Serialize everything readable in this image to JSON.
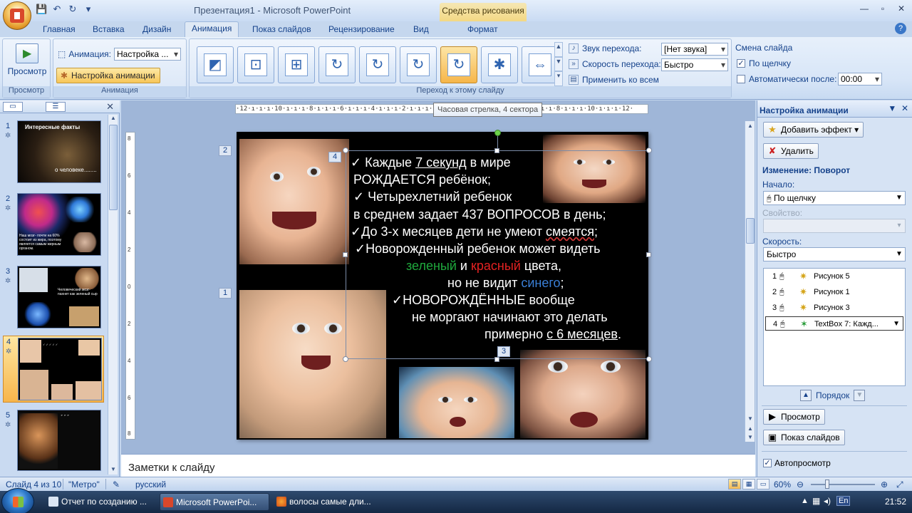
{
  "app": {
    "title": "Презентация1 - Microsoft PowerPoint",
    "contextual_tab": "Средства рисования"
  },
  "tabs": [
    "Главная",
    "Вставка",
    "Дизайн",
    "Анимация",
    "Показ слайдов",
    "Рецензирование",
    "Вид",
    "Формат"
  ],
  "active_tab": "Анимация",
  "ribbon": {
    "preview_group": {
      "button": "Просмотр",
      "label": "Просмотр"
    },
    "animations_group": {
      "animation_label": "Анимация:",
      "animation_value": "Настройка ...",
      "custom_button": "Настройка анимации",
      "label": "Анимация"
    },
    "transition_group": {
      "sound_label": "Звук перехода:",
      "sound_value": "[Нет звука]",
      "speed_label": "Скорость перехода:",
      "speed_value": "Быстро",
      "apply_all": "Применить ко всем",
      "label": "Переход к этому слайду"
    },
    "advance_group": {
      "title": "Смена слайда",
      "on_click": "По щелчку",
      "on_click_checked": true,
      "auto_after": "Автоматически после:",
      "auto_after_checked": false,
      "auto_time": "00:00"
    },
    "gallery_icons": [
      "wipe-icon",
      "box-in-icon",
      "box-out-icon",
      "wheel-1-icon",
      "wheel-2-icon",
      "wheel-3-icon",
      "wheel-4-icon",
      "wheel-8-icon",
      "split-icon"
    ]
  },
  "tooltip": "Часовая стрелка, 4 сектора",
  "ruler": "·12·ı·ı·ı·10·ı·ı·ı·8·ı·ı·ı·6·ı·ı·ı·4·ı·ı·ı·2·ı·ı·ı·0·ı·ı·ı·2·ı·ı·ı·4·ı·ı·ı·6·ı·ı·ı·8·ı·ı·ı·10·ı·ı·ı·12·",
  "ruler_v": [
    "8",
    "6",
    "4",
    "2",
    "0",
    "2",
    "4",
    "6",
    "8"
  ],
  "slides": [
    {
      "num": "1",
      "title": "Интересные факты",
      "sub": "о человеке........"
    },
    {
      "num": "2",
      "title": "",
      "sub": "Наш мозг- почти на 60% состоит из жира, поэтому является самым жирным органом."
    },
    {
      "num": "3",
      "title": "",
      "sub": "Человеческий мозг- пахнет как зеленый сыр"
    },
    {
      "num": "4",
      "title": "",
      "sub": ""
    },
    {
      "num": "5",
      "title": "",
      "sub": ""
    }
  ],
  "slide_content": {
    "l1a": "✓ Каждые ",
    "l1u": "7 секунд",
    "l1b": " в мире",
    "l2": "РОЖДАЕТСЯ ребёнок;",
    "l3": "✓ Четырехлетний ребенок",
    "l4": "в среднем задает 437 ВОПРОСОВ в день;",
    "l5a": "✓До 3-х месяцев дети не умеют ",
    "l5u": "смеятся",
    "l5b": ";",
    "l6": "✓Новорожденный ребенок может видеть",
    "l7g": "зеленый",
    "l7a": " и ",
    "l7r": "красный",
    "l7b": " цвета,",
    "l8a": "но не видит ",
    "l8b": "синего",
    "l8c": ";",
    "l9": "✓НОВОРОЖДЁННЫЕ  вообще",
    "l10": "не моргают начинают это делать",
    "l11a": "примерно ",
    "l11u": "с 6 месяцев",
    "l11b": "."
  },
  "anim_tags": [
    "2",
    "4",
    "1",
    "3"
  ],
  "notes_placeholder": "Заметки к слайду",
  "task_pane": {
    "title": "Настройка анимации",
    "add_effect": "Добавить эффект",
    "remove": "Удалить",
    "change_label": "Изменение: Поворот",
    "start_label": "Начало:",
    "start_value": "По щелчку",
    "property_label": "Свойство:",
    "speed_label": "Скорость:",
    "speed_value": "Быстро",
    "items": [
      {
        "n": "1",
        "name": "Рисунок 5"
      },
      {
        "n": "2",
        "name": "Рисунок 1"
      },
      {
        "n": "3",
        "name": "Рисунок 3"
      },
      {
        "n": "4",
        "name": "TextBox 7:  Кажд..."
      }
    ],
    "order": "Порядок",
    "play": "Просмотр",
    "slideshow": "Показ слайдов",
    "autopreview": "Автопросмотр",
    "autopreview_checked": true
  },
  "status": {
    "slide": "Слайд 4 из 10",
    "theme": "\"Метро\"",
    "lang": "русский",
    "zoom": "60%"
  },
  "taskbar": {
    "items": [
      "Отчет по созданию ...",
      "Microsoft PowerPoi...",
      "волосы самые дли..."
    ],
    "lang": "En",
    "clock": "21:52"
  },
  "colors": {
    "accent": "#f7b54b",
    "ribbon": "#d7e5f7",
    "slide_bg": "#000000"
  }
}
